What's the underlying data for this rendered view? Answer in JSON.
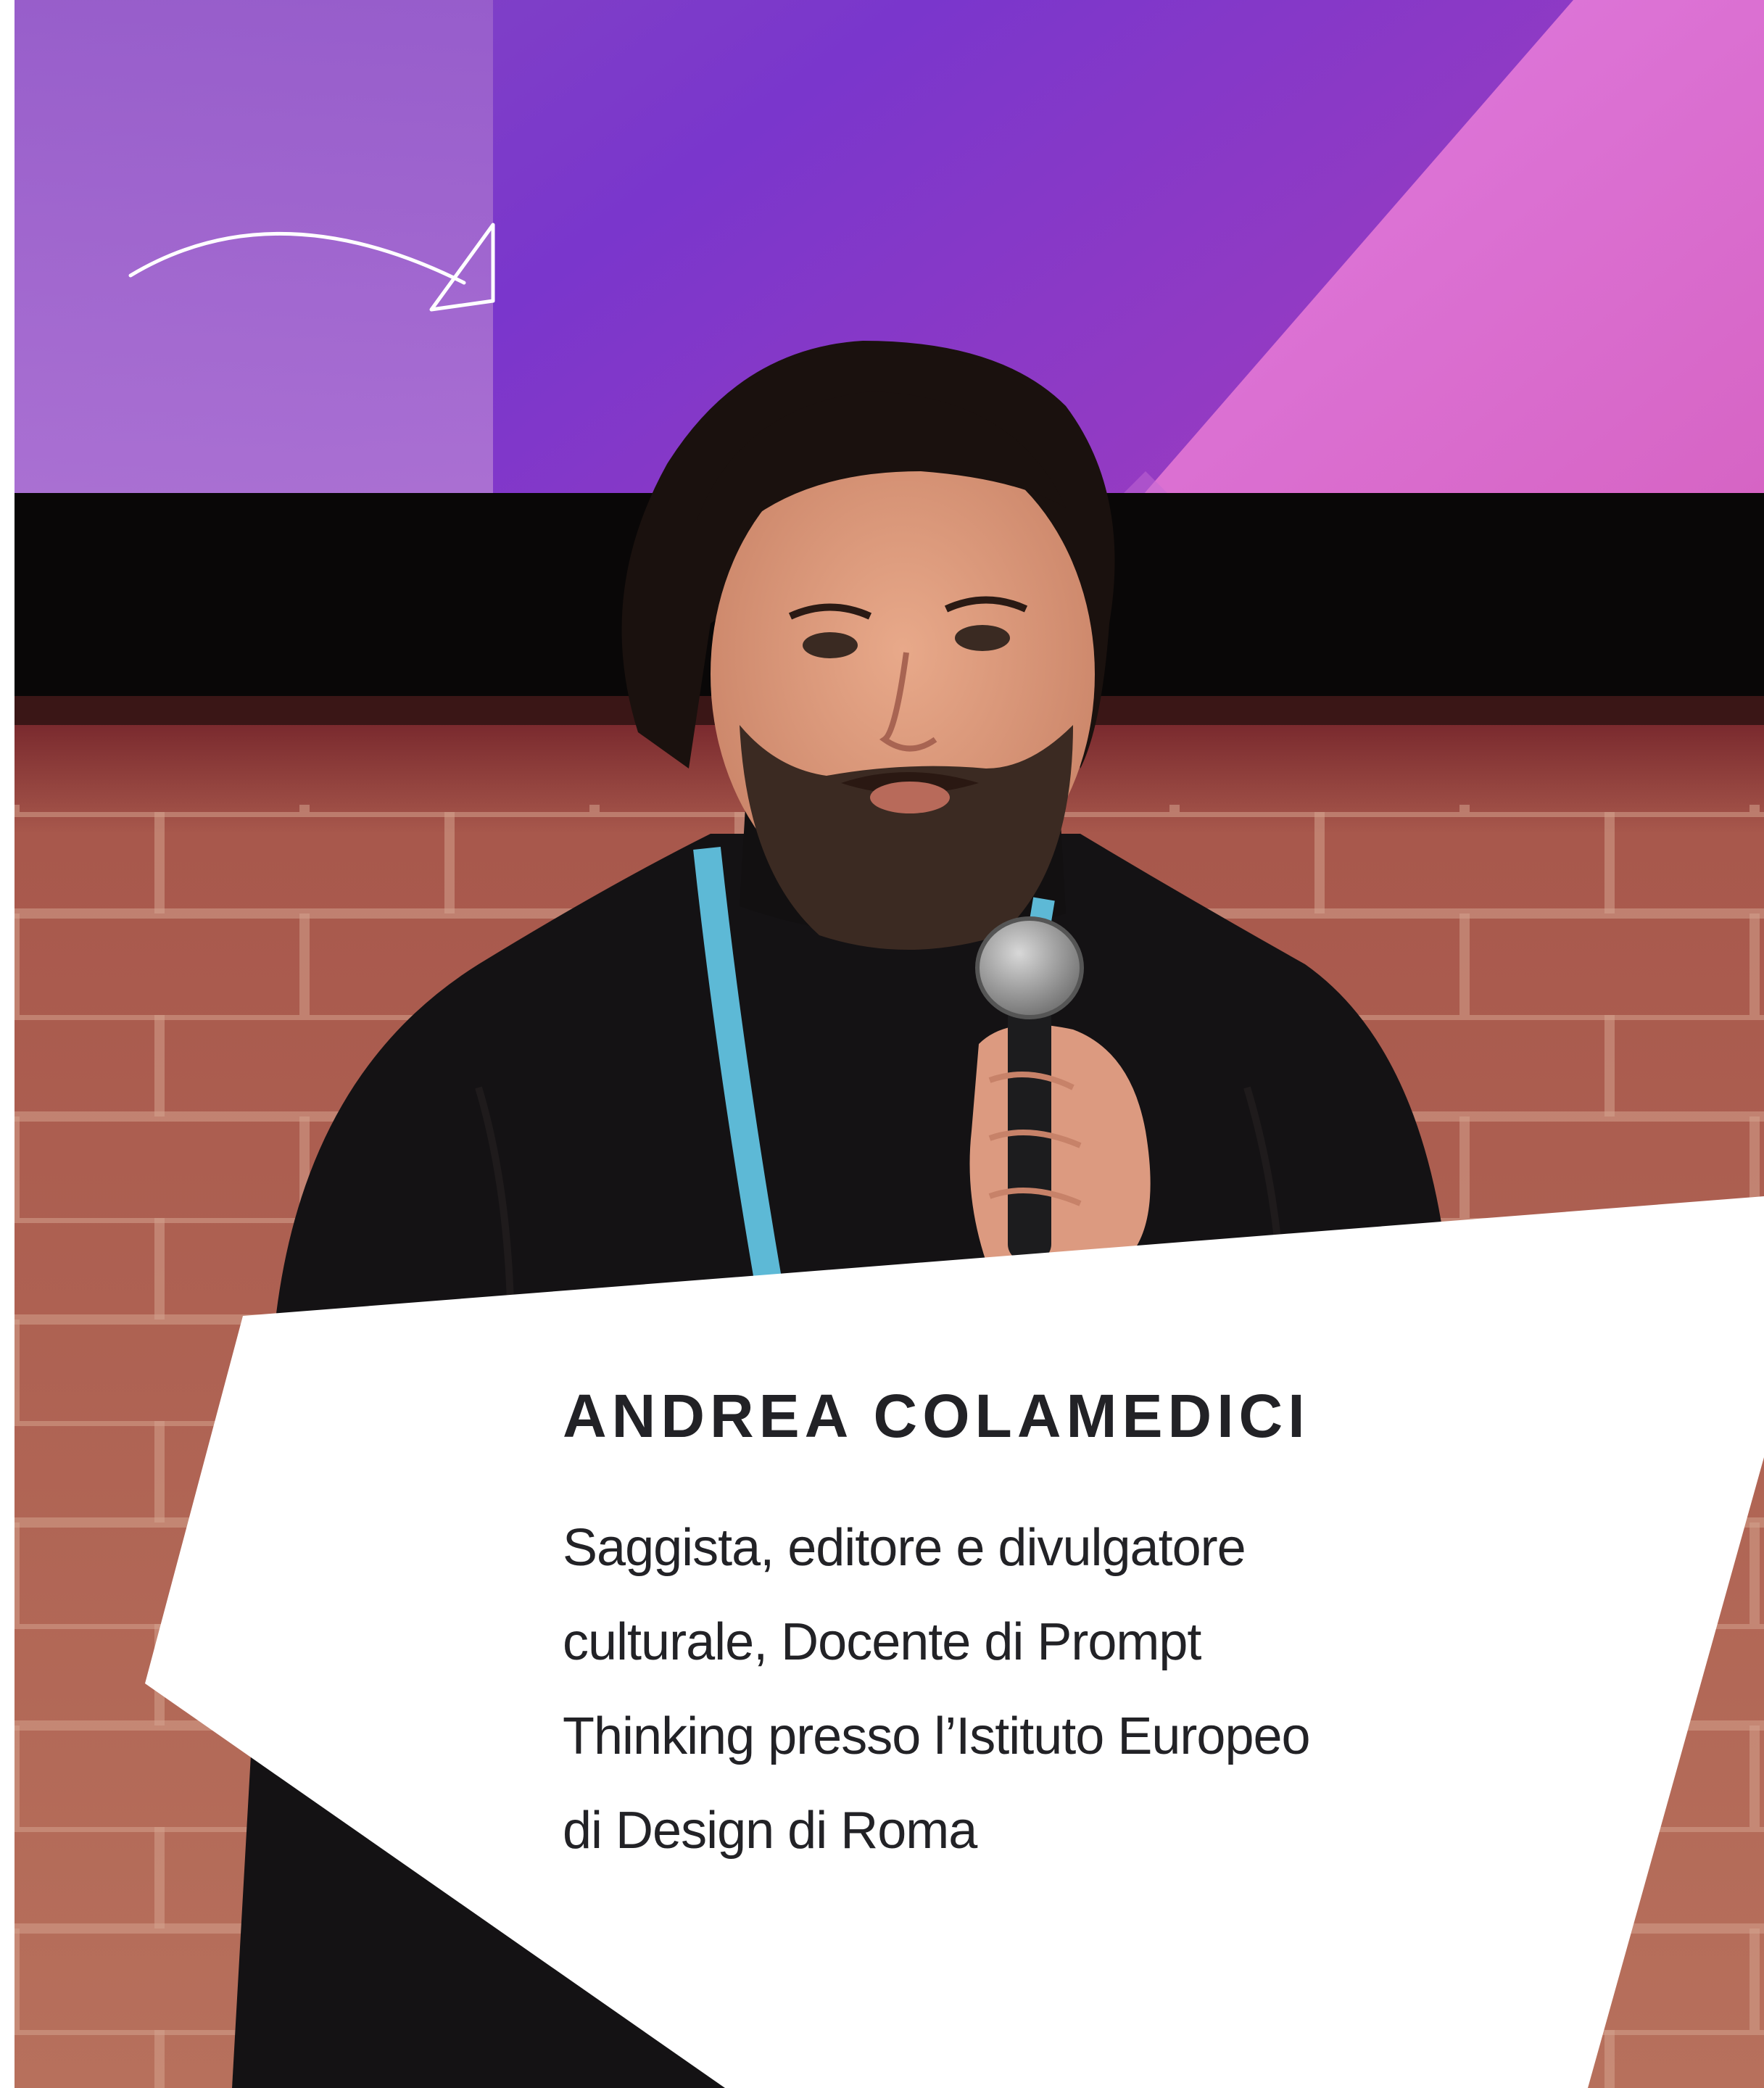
{
  "speaker": {
    "name": "ANDREA COLAMEDICI",
    "bio_lines": [
      "Saggista, editore e divulgatore",
      "culturale, Docente di Prompt",
      "Thinking presso l’Istituto Europeo",
      "di Design di Roma"
    ]
  },
  "photo": {
    "subject": "speaker-holding-microphone-on-stage",
    "icons": [
      "arrow-icon",
      "microphone-icon",
      "lanyard-icon"
    ]
  },
  "colors": {
    "panel": "#ffffff",
    "text": "#222226",
    "backdrop_purple": "#8a3cc8",
    "backdrop_pink": "#d86ad8",
    "wall_brick": "#b7705c",
    "sweater": "#141214",
    "lanyard": "#5db9d6"
  }
}
